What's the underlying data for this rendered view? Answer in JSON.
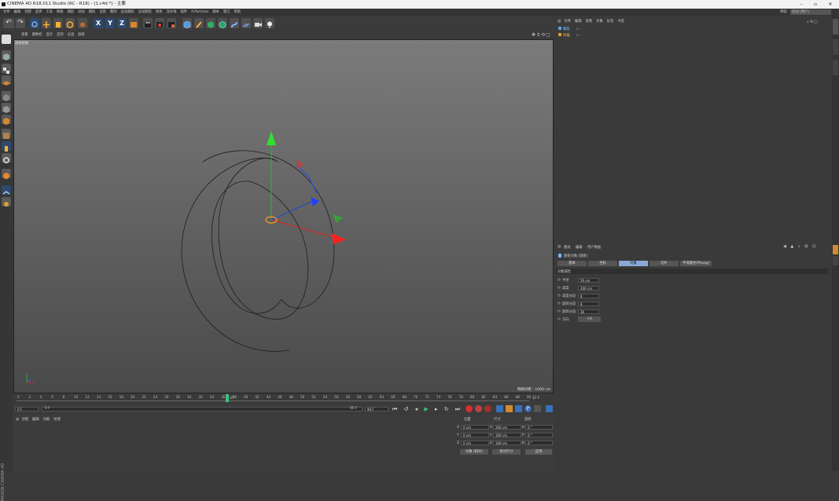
{
  "window": {
    "title": "CINEMA 4D R18.011 Studio (RC - R18) - [1.c4d *] - 主要",
    "layout_label": "界面:",
    "layout_value": "启动 (用户)"
  },
  "menu": [
    "文件",
    "编辑",
    "创建",
    "选择",
    "工具",
    "网格",
    "捕捉",
    "动画",
    "模拟",
    "渲染",
    "雕刻",
    "运动跟踪",
    "运动图形",
    "角色",
    "流水线",
    "插件",
    "X-Particles",
    "脚本",
    "窗口",
    "帮助"
  ],
  "viewport": {
    "menu": [
      "查看",
      "摄像机",
      "显示",
      "选项",
      "过滤",
      "面板"
    ],
    "label": "透视视图",
    "grid_text": "网格间距 : 1000 cm"
  },
  "timeline": {
    "ticks": [
      "0",
      "2",
      "4",
      "6",
      "8",
      "10",
      "12",
      "14",
      "16",
      "18",
      "20",
      "22",
      "24",
      "26",
      "28",
      "30",
      "32",
      "34",
      "36",
      "38",
      "40",
      "42",
      "44",
      "46",
      "48",
      "50",
      "52",
      "54",
      "56",
      "58",
      "60",
      "62",
      "64",
      "66",
      "68",
      "70",
      "72",
      "74",
      "76",
      "78",
      "80",
      "82",
      "84",
      "86",
      "88",
      "90"
    ],
    "current_frame": "37",
    "end_marker": "37 F",
    "start_field": "0 F",
    "range_start": "0 F",
    "range_end": "90 F",
    "end_field": "90 F"
  },
  "materials": {
    "menu": [
      "创建",
      "编辑",
      "功能",
      "纹理"
    ]
  },
  "coords": {
    "headers": [
      "位置",
      "尺寸",
      "旋转"
    ],
    "rows": [
      {
        "axis": "X",
        "pos": "0 cm",
        "size_axis": "X",
        "size": "200 cm",
        "rot_axis": "H",
        "rot": "0 °"
      },
      {
        "axis": "Y",
        "pos": "0 cm",
        "size_axis": "Y",
        "size": "100 cm",
        "rot_axis": "P",
        "rot": "0 °"
      },
      {
        "axis": "Z",
        "pos": "0 cm",
        "size_axis": "Z",
        "size": "100 cm",
        "rot_axis": "B",
        "rot": "0 °"
      }
    ],
    "mode_select": "对象 (相对)",
    "size_select": "绝对尺寸",
    "apply": "应用"
  },
  "object_manager": {
    "menu": [
      "文件",
      "编辑",
      "查看",
      "对象",
      "标签",
      "书签"
    ],
    "objects": [
      {
        "name": "螺旋",
        "color": "#5aa0e6"
      },
      {
        "name": "扫描",
        "color": "#e09a30"
      }
    ]
  },
  "attributes": {
    "menu": [
      "模式",
      "编辑",
      "用户数据"
    ],
    "title": "圆锥对象 [圆锥]",
    "tabs": [
      "基本",
      "坐标",
      "对象",
      "切片",
      "平滑着色(Phong)"
    ],
    "active_tab": 2,
    "section": "对象属性",
    "fields": [
      {
        "label": "半径",
        "value": "50 cm"
      },
      {
        "label": "高度",
        "value": "200 cm"
      },
      {
        "label": "高度分段",
        "value": "8"
      },
      {
        "label": "旋转分段",
        "value": "8"
      },
      {
        "label": "旋转分段",
        "value": "36"
      }
    ],
    "direction_label": "方向",
    "direction_value": "+X"
  },
  "brand": "MAXON CINEMA 4D",
  "colors": {
    "accent": "#3b6fb6",
    "active_frame": "#3cc27a",
    "x_axis": "#e02020",
    "y_axis": "#20c020",
    "z_axis": "#2040e0"
  }
}
